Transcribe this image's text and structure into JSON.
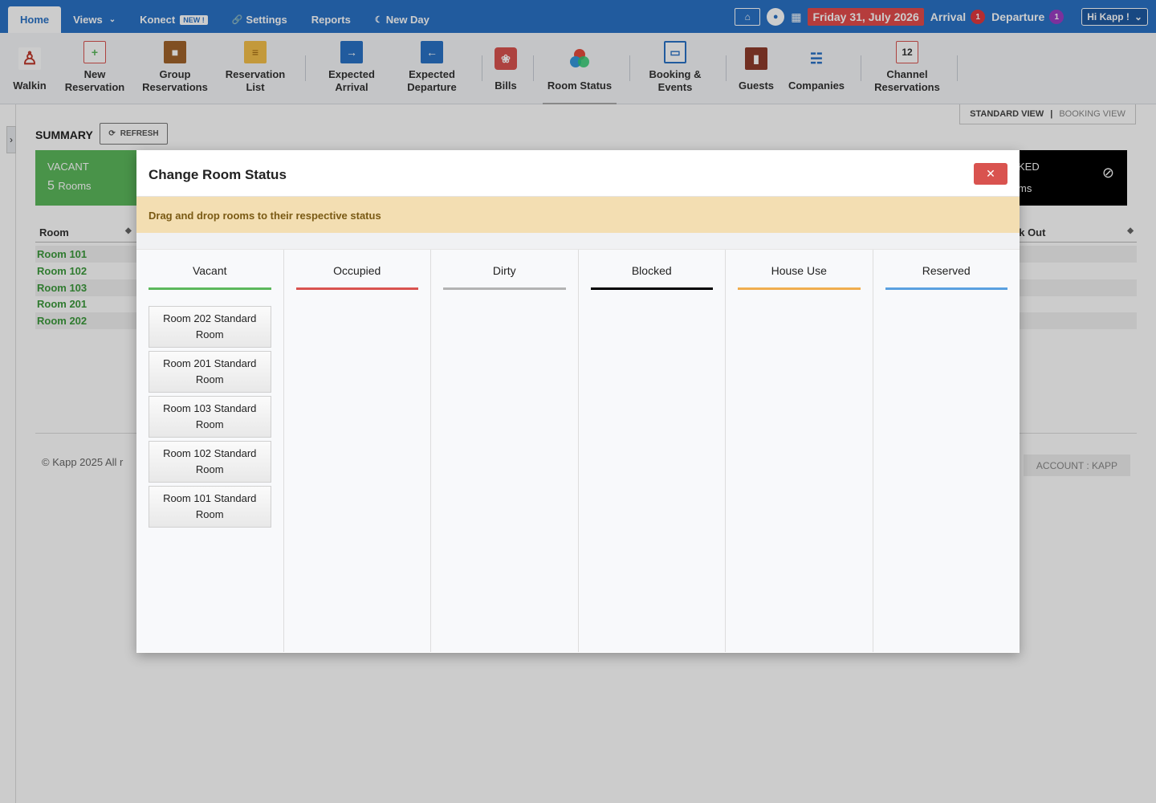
{
  "topnav": {
    "home": "Home",
    "views": "Views",
    "konekt": "Konect",
    "konekt_tag": "NEW !",
    "settings": "Settings",
    "reports": "Reports",
    "newday": "New Day"
  },
  "topright": {
    "date": "Friday 31, July 2026",
    "arrival_label": "Arrival",
    "arrival_count": "1",
    "departure_label": "Departure",
    "departure_count": "1",
    "user": "Hi Kapp !"
  },
  "toolbar": {
    "walkin": "Walkin",
    "new_res_1": "New",
    "new_res_2": "Reservation",
    "group_1": "Group",
    "group_2": "Reservations",
    "reslist_1": "Reservation",
    "reslist_2": "List",
    "exp_arr_1": "Expected",
    "exp_arr_2": "Arrival",
    "exp_dep_1": "Expected",
    "exp_dep_2": "Departure",
    "bills": "Bills",
    "room_status": "Room Status",
    "booking_1": "Booking &",
    "booking_2": "Events",
    "guests": "Guests",
    "companies": "Companies",
    "channel_1": "Channel",
    "channel_2": "Reservations",
    "channel_num": "12"
  },
  "page": {
    "standard_view": "STANDARD VIEW",
    "separator": "|",
    "booking_view": "BOOKING VIEW",
    "summary": "SUMMARY",
    "refresh": "REFRESH",
    "vacant_label": "VACANT",
    "vacant_count": "5",
    "vacant_unit": "Rooms",
    "blocked_partial": "KED",
    "blocked_unit_partial": "ms",
    "col_room": "Room",
    "col_checkout": "ck Out",
    "rows": [
      "Room 101",
      "Room 102",
      "Room 103",
      "Room 201",
      "Room 202"
    ],
    "footer_left": "© Kapp 2025 All r",
    "footer_right": "ACCOUNT : KAPP"
  },
  "modal": {
    "title": "Change Room Status",
    "notice": "Drag and drop rooms to their respective status",
    "columns": [
      {
        "label": "Vacant",
        "color": "#5cb85c"
      },
      {
        "label": "Occupied",
        "color": "#d9534f"
      },
      {
        "label": "Dirty",
        "color": "#b3b3b3"
      },
      {
        "label": "Blocked",
        "color": "#000000"
      },
      {
        "label": "House Use",
        "color": "#f0ad4e"
      },
      {
        "label": "Reserved",
        "color": "#5aa0e0"
      }
    ],
    "vacant_rooms": [
      "Room 202 Standard Room",
      "Room 201 Standard Room",
      "Room 103 Standard Room",
      "Room 102 Standard Room",
      "Room 101 Standard Room"
    ]
  }
}
